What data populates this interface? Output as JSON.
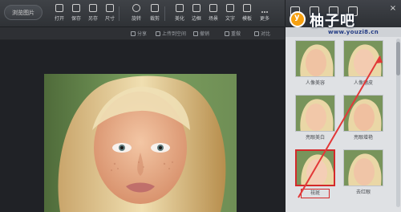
{
  "toolbar": {
    "browse_button": "浏览图片",
    "tools": [
      {
        "label": "打开",
        "icon": "folder-icon"
      },
      {
        "label": "保存",
        "icon": "save-icon"
      },
      {
        "label": "另存",
        "icon": "save-as-icon"
      },
      {
        "label": "尺寸",
        "icon": "resize-icon"
      },
      {
        "label": "旋转",
        "icon": "rotate-icon"
      },
      {
        "label": "裁剪",
        "icon": "crop-icon"
      },
      {
        "label": "美化",
        "icon": "beautify-icon"
      },
      {
        "label": "边框",
        "icon": "frame-icon"
      },
      {
        "label": "场景",
        "icon": "scene-icon"
      },
      {
        "label": "文字",
        "icon": "text-icon"
      },
      {
        "label": "模板",
        "icon": "template-icon"
      },
      {
        "label": "更多",
        "icon": "more-icon"
      }
    ]
  },
  "subbar": {
    "share": "分享",
    "upload": "上传到空间",
    "undo": "撤销",
    "redo": "重做",
    "compare": "对比"
  },
  "watermark": {
    "logo_letter": "y",
    "title": "柚子吧",
    "url": "www.youzi8.cn"
  },
  "panel": {
    "thumbnails": [
      {
        "label": "人像美容",
        "selected": false
      },
      {
        "label": "人像磨皮",
        "selected": false
      },
      {
        "label": "亮眼美白",
        "selected": false
      },
      {
        "label": "亮眼增艳",
        "selected": false
      },
      {
        "label": "祛斑",
        "selected": true
      },
      {
        "label": "去红眼",
        "selected": false
      }
    ]
  }
}
